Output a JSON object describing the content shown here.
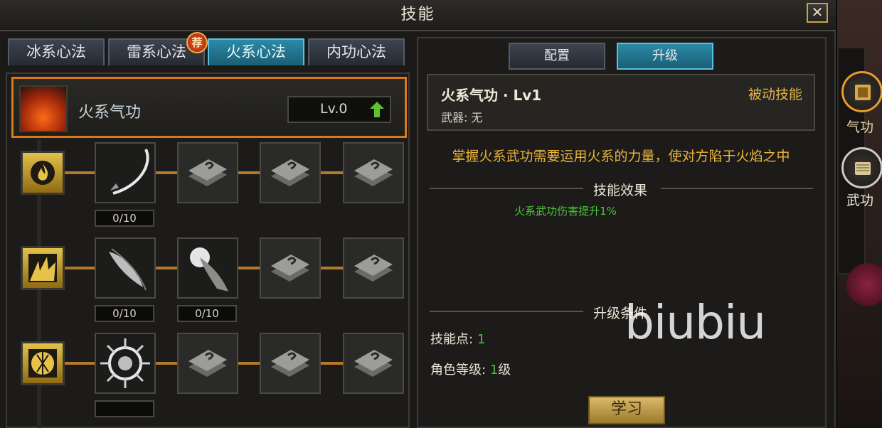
{
  "window": {
    "title": "技能",
    "close_label": "✕"
  },
  "tabs": [
    {
      "label": "冰系心法",
      "active": false
    },
    {
      "label": "雷系心法",
      "active": false
    },
    {
      "label": "火系心法",
      "active": true
    },
    {
      "label": "内功心法",
      "active": false
    }
  ],
  "recommend_badge": "荐",
  "skill_header": {
    "name": "火系气功",
    "level": "Lv.0"
  },
  "skill_tree": {
    "row1": {
      "counters": [
        "0/10"
      ]
    },
    "row2": {
      "counters": [
        "0/10",
        "0/10"
      ]
    },
    "row3": {
      "counters": [
        ""
      ]
    }
  },
  "detail_tabs": [
    {
      "label": "配置",
      "active": false
    },
    {
      "label": "升级",
      "active": true
    }
  ],
  "detail": {
    "name": "火系气功 · Lv1",
    "type": "被动技能",
    "weapon": "武器: 无",
    "description": "掌握火系武功需要运用火系的力量，使对方陷于火焰之中",
    "effect_title": "技能效果",
    "effect_text": "火系武功伤害提升1%",
    "conditions_title": "升级条件",
    "skill_points_label": "技能点:",
    "skill_points_value": "1",
    "char_level_label": "角色等级:",
    "char_level_value": "1",
    "char_level_unit": "级",
    "learn_label": "学习"
  },
  "sidebar": [
    {
      "label": "气功",
      "active": true
    },
    {
      "label": "武功",
      "active": false
    }
  ],
  "watermark": "biubiu",
  "colors": {
    "accent_orange": "#d8791d",
    "active_tab": "#2c8aa6",
    "gold_text": "#e9b43a",
    "green_text": "#4cc23a"
  }
}
